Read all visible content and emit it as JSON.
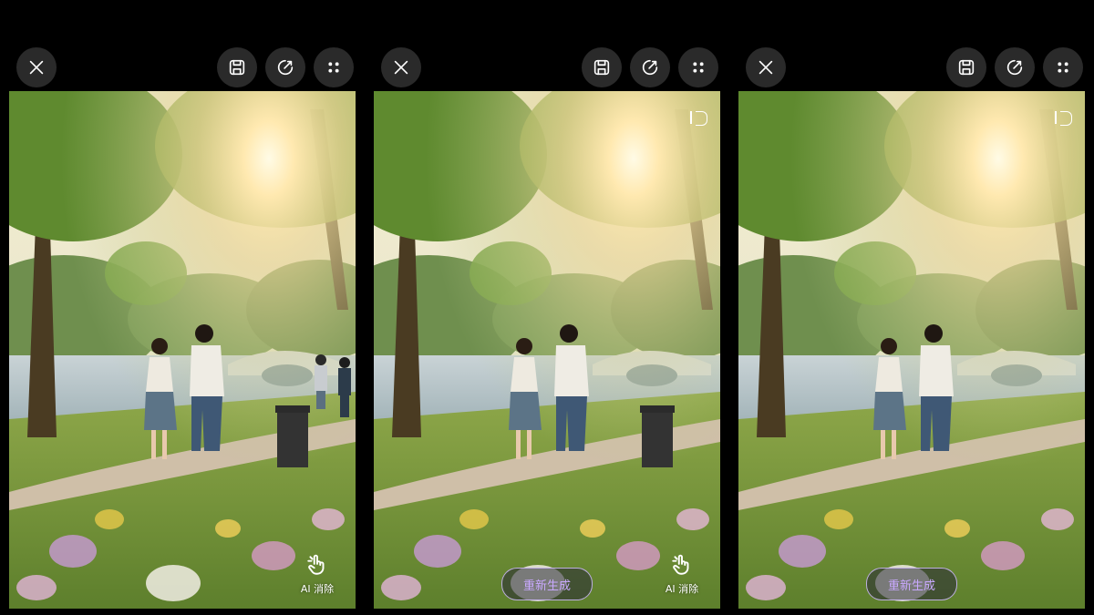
{
  "panels": [
    {
      "ai_erase_label": "AI 消除",
      "regenerate_label": null
    },
    {
      "ai_erase_label": "AI 消除",
      "regenerate_label": "重新生成"
    },
    {
      "ai_erase_label": null,
      "regenerate_label": "重新生成"
    }
  ],
  "icons": {
    "close": "close-icon",
    "save": "save-icon",
    "edit": "edit-icon",
    "more": "more-icon",
    "ai_erase": "tap-hand-icon"
  },
  "colors": {
    "background": "#000000",
    "button_bg": "#2a2a2a",
    "regenerate_text": "#c9a9ff"
  }
}
